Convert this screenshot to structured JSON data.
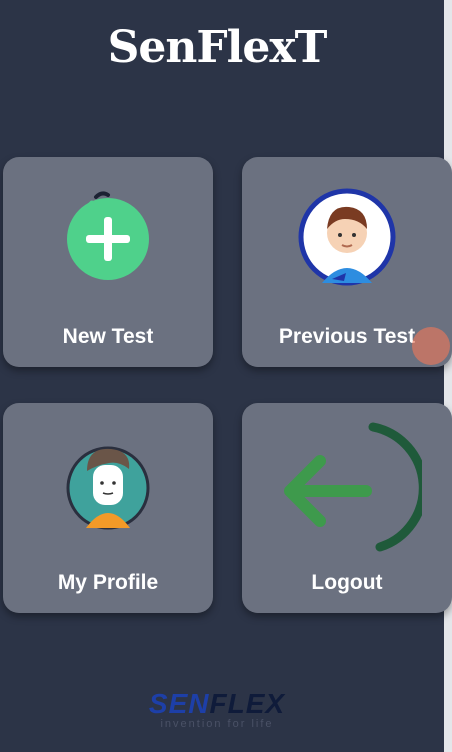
{
  "app": {
    "title": "SenFlexT"
  },
  "menu": {
    "new_test": {
      "label": "New Test",
      "icon": "add-circle-icon"
    },
    "previous_test": {
      "label": "Previous Test",
      "icon": "boy-avatar-icon"
    },
    "my_profile": {
      "label": "My Profile",
      "icon": "profile-avatar-icon"
    },
    "logout": {
      "label": "Logout",
      "icon": "logout-arrow-icon"
    }
  },
  "brand": {
    "sen": "SEN",
    "flex": "FLEX",
    "tagline": "invention for life"
  },
  "colors": {
    "background": "#2c3447",
    "tile": "#6b7180",
    "accent_green": "#4fd18b",
    "logout_green": "#3e9a4c"
  }
}
